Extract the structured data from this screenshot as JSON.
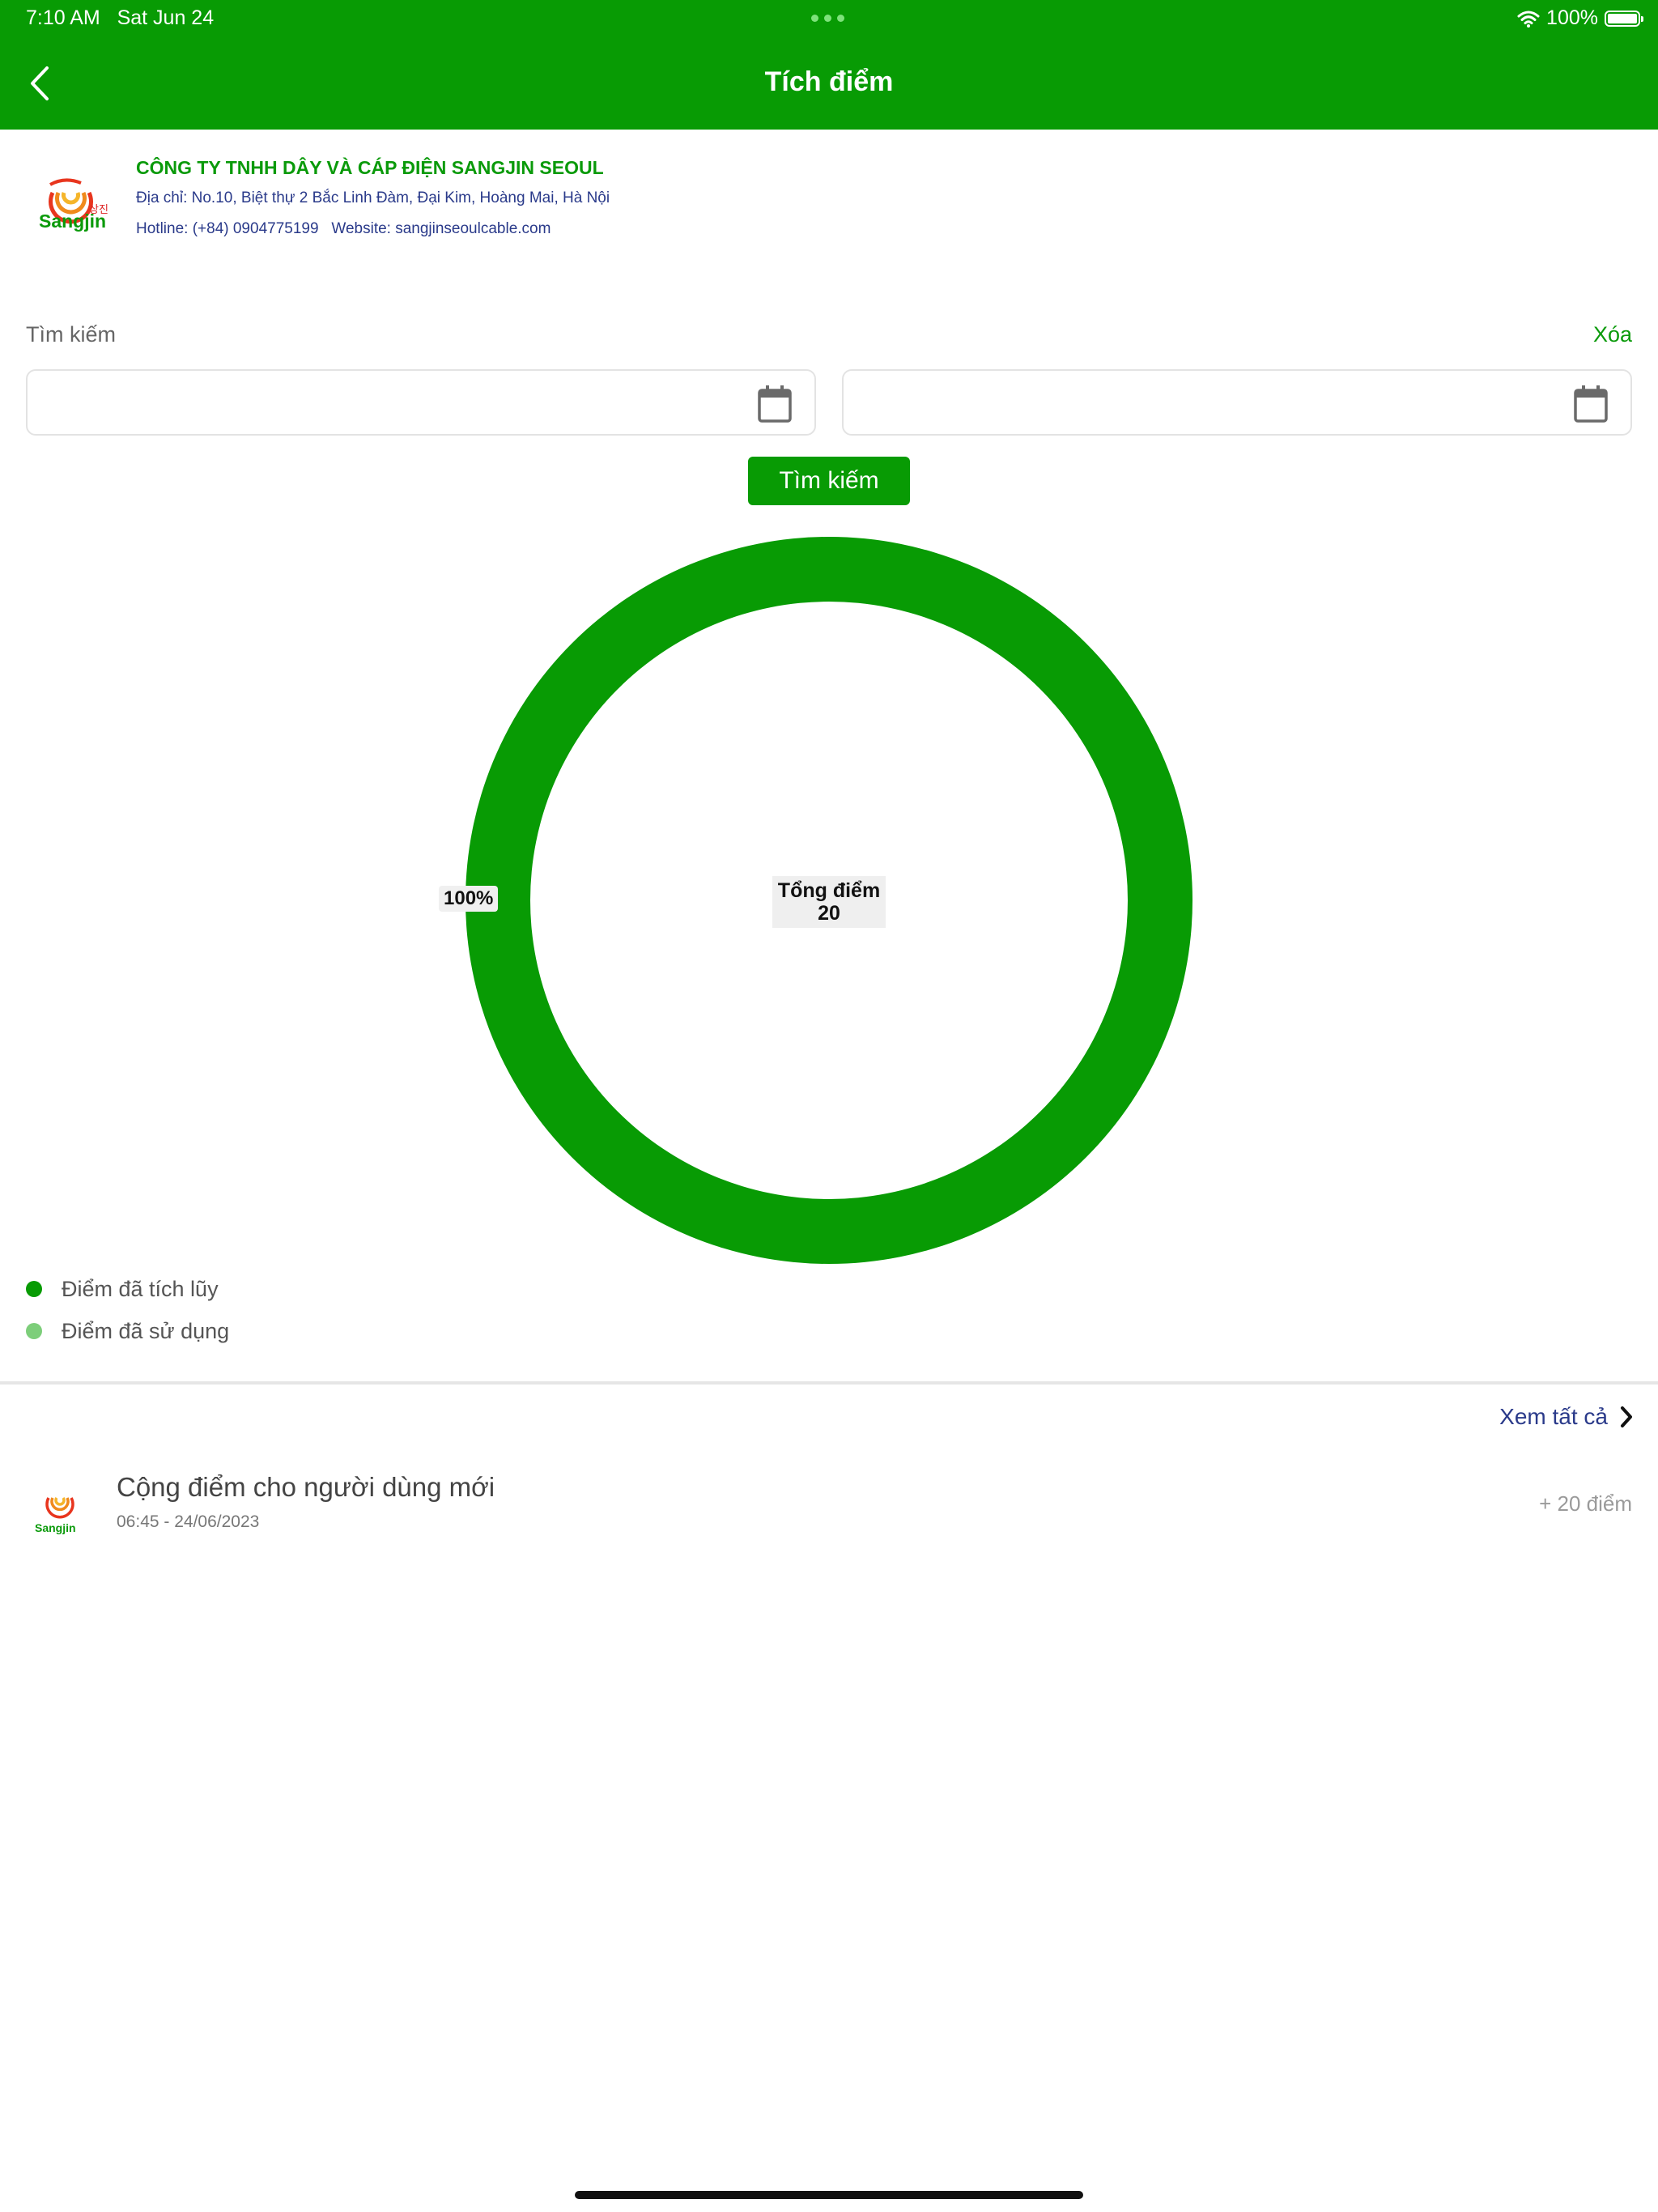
{
  "status": {
    "time": "7:10 AM",
    "date": "Sat Jun 24",
    "battery": "100%"
  },
  "header": {
    "title": "Tích điểm"
  },
  "company": {
    "name": "CÔNG TY TNHH DÂY VÀ CÁP ĐIỆN SANGJIN SEOUL",
    "address": "Địa chỉ: No.10, Biệt thự 2 Bắc Linh Đàm, Đại Kim, Hoàng Mai, Hà Nội",
    "contact": "Hotline: (+84) 0904775199   Website: sangjinseoulcable.com",
    "logo_text": "Sangjin",
    "logo_korean": "상진"
  },
  "search": {
    "label": "Tìm kiếm",
    "clear_label": "Xóa",
    "from_date": "",
    "to_date": "",
    "button_label": "Tìm kiếm"
  },
  "chart_data": {
    "type": "pie",
    "variant": "donut",
    "series": [
      {
        "name": "Điểm đã tích lũy",
        "value": 20,
        "percent": 100,
        "color": "#089b04"
      },
      {
        "name": "Điểm đã sử dụng",
        "value": 0,
        "percent": 0,
        "color": "#7dce7a"
      }
    ],
    "slice_label": "100%",
    "center_title": "Tổng điểm",
    "center_value": "20"
  },
  "legend": [
    {
      "label": "Điểm đã tích lũy",
      "color": "#089b04"
    },
    {
      "label": "Điểm đã sử dụng",
      "color": "#7dce7a"
    }
  ],
  "history": {
    "view_all_label": "Xem tất cả",
    "items": [
      {
        "title": "Cộng điểm cho người dùng mới",
        "time": "06:45 - 24/06/2023",
        "points": "+ 20 điểm"
      }
    ]
  },
  "colors": {
    "brand": "#089b04",
    "accent_light": "#7dce7a",
    "link_blue": "#2a3a8a"
  }
}
